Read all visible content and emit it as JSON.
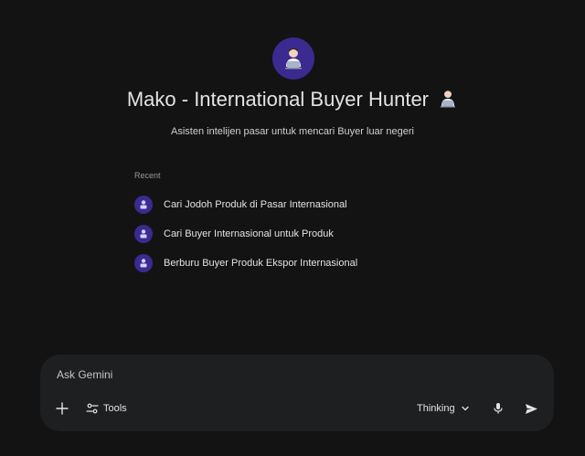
{
  "gem": {
    "title": "Mako - International Buyer Hunter",
    "title_emoji_icon": "person-with-laptop-icon",
    "subtitle": "Asisten intelijen pasar untuk mencari Buyer luar negeri",
    "avatar_icon": "person-with-laptop-icon",
    "accent_color": "#3b2a8f"
  },
  "recent": {
    "label": "Recent",
    "items": [
      {
        "label": "Cari Jodoh Produk di Pasar Internasional",
        "icon": "gem-icon"
      },
      {
        "label": "Cari Buyer Internasional untuk Produk",
        "icon": "gem-icon"
      },
      {
        "label": "Berburu Buyer Produk Ekspor Internasional",
        "icon": "gem-icon"
      }
    ]
  },
  "composer": {
    "placeholder": "Ask Gemini",
    "value": "",
    "plus_icon": "plus-icon",
    "tools_label": "Tools",
    "tools_icon": "sliders-icon",
    "mode_label": "Thinking",
    "mode_icon": "chevron-down-icon",
    "mic_icon": "microphone-icon",
    "send_icon": "send-icon"
  }
}
